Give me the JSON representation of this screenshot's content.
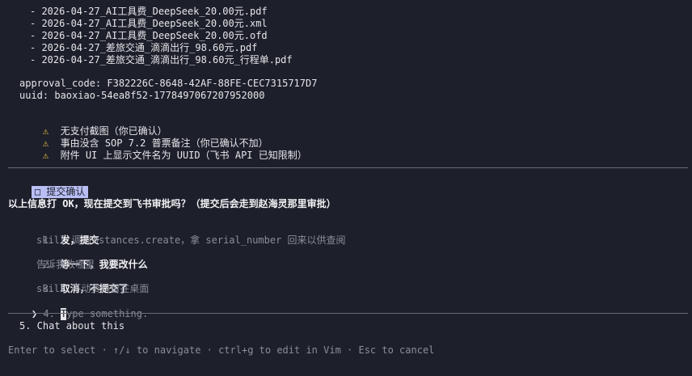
{
  "files": [
    "- 2026-04-27_AI工具费_DeepSeek_20.00元.pdf",
    "- 2026-04-27_AI工具费_DeepSeek_20.00元.xml",
    "- 2026-04-27_AI工具费_DeepSeek_20.00元.ofd",
    "- 2026-04-27_差旅交通_滴滴出行_98.60元.pdf",
    "- 2026-04-27_差旅交通_滴滴出行_98.60元_行程单.pdf"
  ],
  "approval_code": "approval_code: F382226C-8648-42AF-88FE-CEC7315717D7",
  "uuid": "uuid: baoxiao-54ea8f52-1778497067207952000",
  "warnings": [
    "无支付截图（你已确认）",
    "事由没含 SOP 7.2 普票备注（你已确认不加）",
    "附件 UI 上显示文件名为 UUID（飞书 API 已知限制）"
  ],
  "section_badge": "□ 提交确认",
  "question": "以上信息打 OK，现在提交到飞书审批吗？（提交后会走到赵海灵那里审批）",
  "options": [
    {
      "num": "1.",
      "label": "发，提交",
      "desc": "skill 调 instances.create，拿 serial_number 回来以供查阅"
    },
    {
      "num": "2.",
      "label": "等一下，我要改什么",
      "desc": "告诉我改哪里"
    },
    {
      "num": "3.",
      "label": "取消，不提交了",
      "desc": "skill 不动资料留在桌面"
    }
  ],
  "input_option": {
    "pointer": "❯",
    "num": "4.",
    "cursor_char": "T",
    "placeholder": "ype something."
  },
  "chat_option": "5. Chat about this",
  "footer": "Enter to select · ↑/↓ to navigate · ctrl+g to edit in Vim · Esc to cancel",
  "colors": {
    "background": "#1d1f2a",
    "warning": "#f5c542",
    "badge": "#b9bff4",
    "dim": "#8b8d98"
  },
  "icons": {
    "warning": "warning-icon",
    "pointer": "chevron-right-icon",
    "checkbox": "checkbox-icon"
  }
}
